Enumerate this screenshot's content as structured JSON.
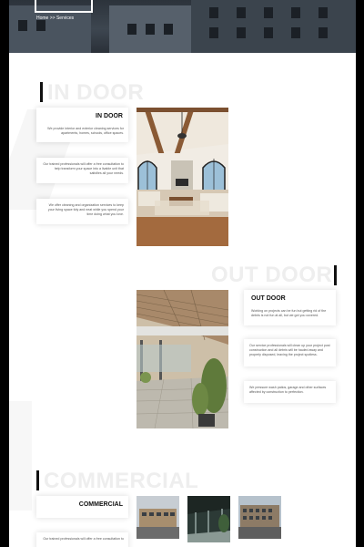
{
  "breadcrumb": {
    "home": "Home",
    "separator": ">>",
    "current": "Services"
  },
  "indoor": {
    "title": "IN DOOR",
    "card_heading": "IN DOOR",
    "intro": "We provide interior and exterior cleaning services for apartments, homes, schools, office spaces.",
    "paragraph_1": "Our trained professionals will offer a free consultation to help transform your space into a livable unit that satisfies all your needs.",
    "paragraph_2": "We offer cleaning and organization services to keep your living space tidy and neat while you spend your time doing what you love.",
    "image_alt": "living-room-interior-photo"
  },
  "outdoor": {
    "title": "OUT DOOR",
    "card_heading": "OUT DOOR",
    "intro": "Working on projects can be fun but getting rid of the debris is not fun at all, but we got you covered.",
    "paragraph_1": "Our service professionals will clean up your project post construction and all debris will be hauled away and properly disposed, leaving the project spotless.",
    "paragraph_2": "We pressure wash patios, garage and other surfaces affected by construction to perfection.",
    "image_alt": "patio-pergola-photo"
  },
  "commercial": {
    "title": "COMMERCIAL",
    "card_heading": "COMMERCIAL",
    "paragraph_1": "Our trained professionals will offer a free consultation to"
  },
  "colors": {
    "accent": "#111111",
    "title_fade": "#eeeeee",
    "page_bg": "#ffffff",
    "frame_bg": "#000000"
  }
}
